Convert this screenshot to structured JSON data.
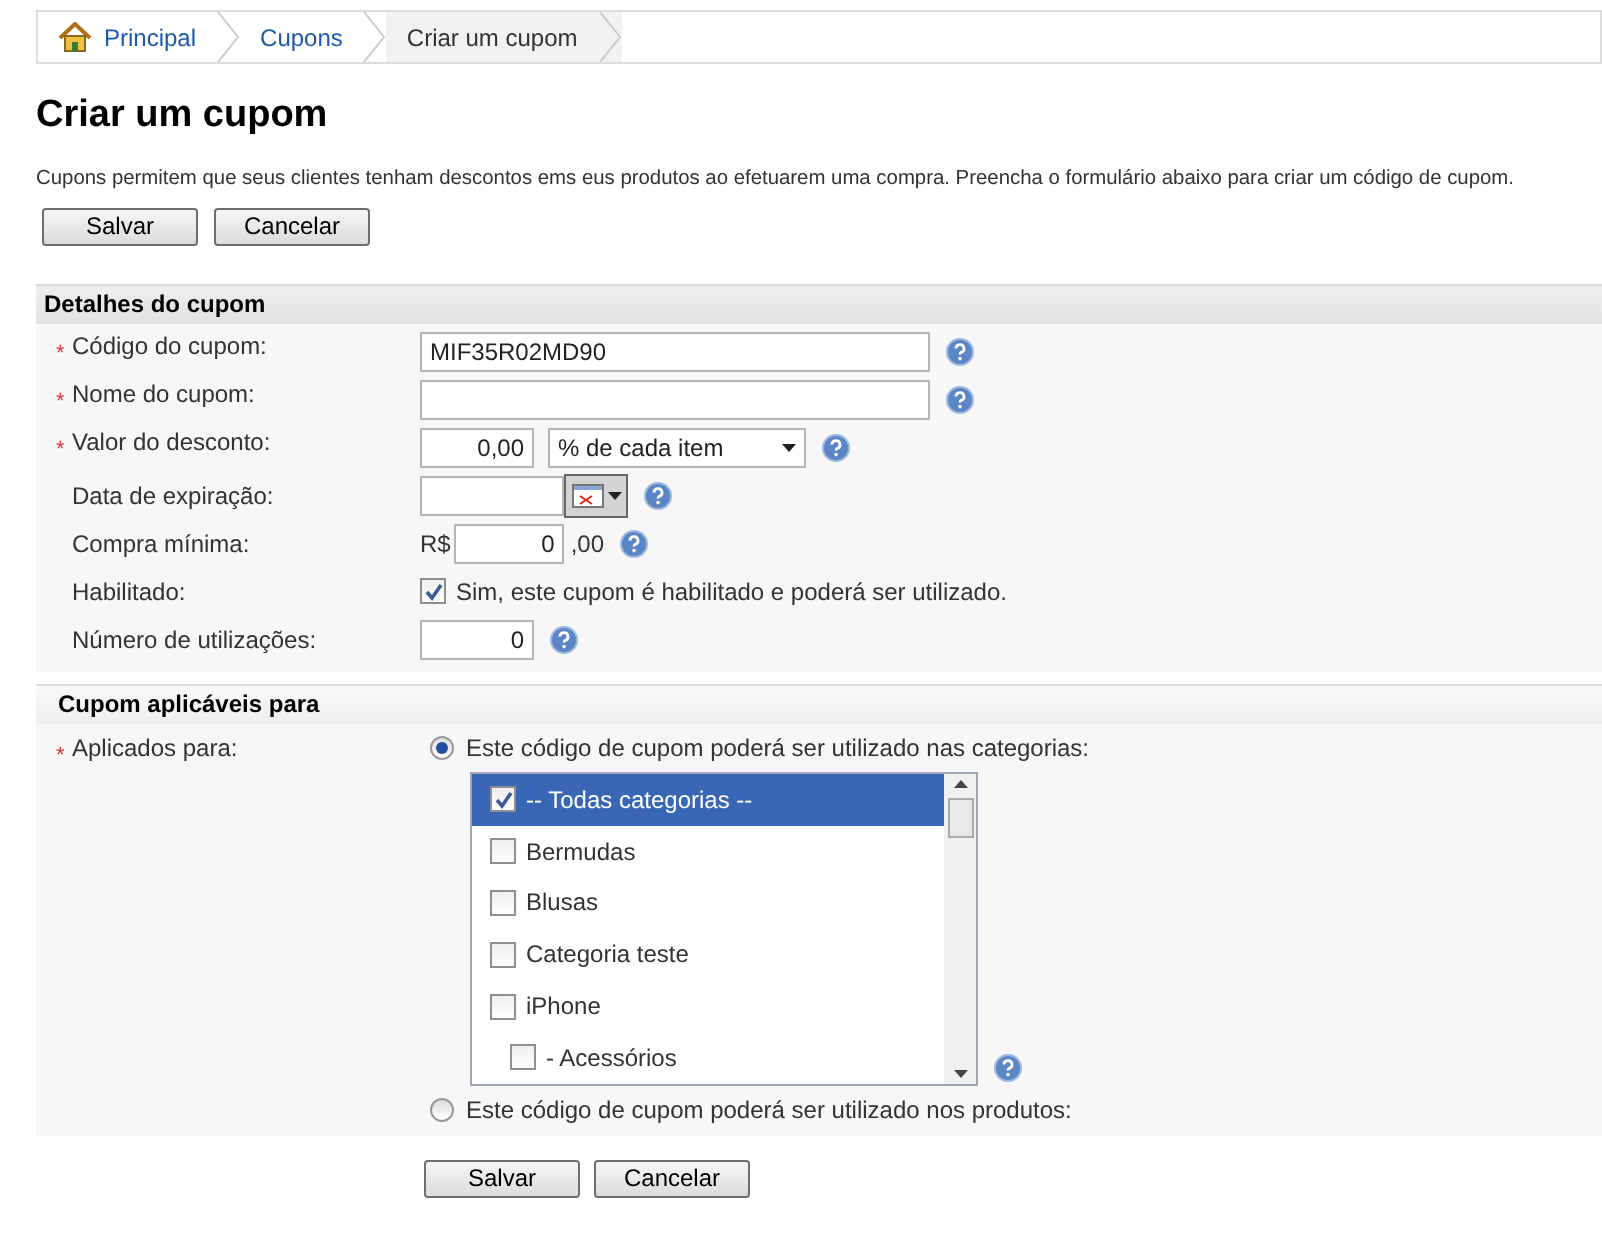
{
  "breadcrumb": [
    {
      "label": "Principal",
      "kind": "home",
      "current": false
    },
    {
      "label": "Cupons",
      "kind": "link",
      "current": false
    },
    {
      "label": "Criar um cupom",
      "kind": "link",
      "current": true
    }
  ],
  "title": "Criar um cupom",
  "description": "Cupons permitem que seus clientes tenham descontos ems eus produtos ao efetuarem uma compra. Preencha o formulário abaixo para criar um código de cupom.",
  "top_buttons": [
    "Salvar",
    "Cancelar"
  ],
  "details": {
    "heading": "Detalhes do cupom",
    "fields": [
      {
        "kind": "text",
        "label": "Código do cupom:",
        "marker": "*",
        "help": true,
        "value": "MIF35R02MD90"
      },
      {
        "kind": "text",
        "label": "Nome do cupom:",
        "marker": "*",
        "help": true
      },
      {
        "kind": "discount",
        "label": "Valor do desconto:",
        "marker": "*",
        "help": true,
        "value": "0,00",
        "unit": "% de cada item"
      },
      {
        "kind": "date",
        "label": "Data de expiração:",
        "help": true
      },
      {
        "kind": "currency",
        "label": "Compra mínima:",
        "help": true,
        "prefix": "R$",
        "value": "0",
        "suffix": ",00"
      },
      {
        "kind": "checkbox",
        "label": "Habilitado:",
        "help": false,
        "checked": true,
        "text": "Sim, este cupom é habilitado e poderá ser utilizado."
      },
      {
        "kind": "number",
        "label": "Número de utilizações:",
        "help": true,
        "value": "0"
      }
    ]
  },
  "applicable": {
    "heading": "Cupom aplicáveis para",
    "label": "Aplicados para:",
    "marker": "*",
    "options": [
      {
        "label": "Este código de cupom poderá ser utilizado nas categorias:",
        "selected": true
      },
      {
        "label": "Este código de cupom poderá ser utilizado nos produtos:",
        "selected": false
      }
    ],
    "categories": [
      {
        "label": "-- Todas categorias --",
        "checked": true,
        "selected": true
      },
      {
        "label": "Bermudas",
        "checked": false,
        "selected": false
      },
      {
        "label": "Blusas",
        "checked": false,
        "selected": false
      },
      {
        "label": "Categoria teste",
        "checked": false,
        "selected": false
      },
      {
        "label": "iPhone",
        "checked": false,
        "selected": false,
        "children": [
          {
            "label": "- Acessórios",
            "checked": false,
            "selected": false
          }
        ]
      }
    ]
  },
  "bottom_buttons": [
    "Salvar",
    "Cancelar"
  ]
}
